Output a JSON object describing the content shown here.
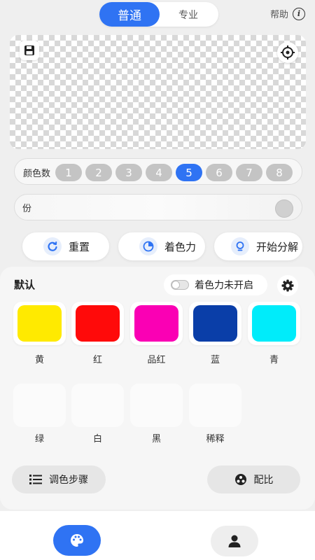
{
  "tabs": [
    {
      "label": "普通",
      "active": true
    },
    {
      "label": "专业",
      "active": false
    }
  ],
  "help": {
    "label": "帮助",
    "icon": "info-icon"
  },
  "canvas": {
    "save_icon": "save-icon",
    "target_icon": "crosshair-icon"
  },
  "color_count": {
    "label": "颜色数",
    "options": [
      "1",
      "2",
      "3",
      "4",
      "5",
      "6",
      "7",
      "8"
    ],
    "selected": "5"
  },
  "portion": {
    "label": "份"
  },
  "actions": [
    {
      "label": "重置",
      "icon": "reset-icon"
    },
    {
      "label": "着色力",
      "icon": "pie-chart-icon"
    },
    {
      "label": "开始分解",
      "icon": "bulb-icon"
    }
  ],
  "panel": {
    "title": "默认",
    "toggle_label": "着色力未开启",
    "settings_icon": "gear-icon"
  },
  "colors": [
    {
      "name": "黄",
      "hex": "#ffea00"
    },
    {
      "name": "红",
      "hex": "#ff0a0a"
    },
    {
      "name": "品红",
      "hex": "#fa00b4"
    },
    {
      "name": "蓝",
      "hex": "#0a3ea8"
    },
    {
      "name": "青",
      "hex": "#00ecfa"
    }
  ],
  "extra_colors": [
    {
      "name": "绿"
    },
    {
      "name": "白"
    },
    {
      "name": "黑"
    },
    {
      "name": "稀释"
    }
  ],
  "bottom_buttons": {
    "steps_label": "调色步骤",
    "ratio_label": "配比"
  },
  "nav": {
    "palette_icon": "palette-icon",
    "user_icon": "user-icon"
  },
  "accent": "#2f73f3"
}
